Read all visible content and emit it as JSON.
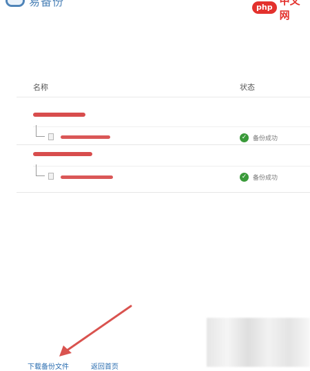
{
  "header": {
    "logo_text": "易备份",
    "watermark": {
      "badge": "php",
      "text": "中文网"
    }
  },
  "table": {
    "columns": {
      "name": "名称",
      "status": "状态"
    },
    "rows": [
      {
        "status_text": "备份成功"
      },
      {
        "status_text": "备份成功"
      }
    ]
  },
  "footer": {
    "links": [
      "下载备份文件",
      "返回首页"
    ]
  },
  "colors": {
    "accent": "#4f84b8",
    "success": "#3a9a3a",
    "redaction": "#d43a3a",
    "arrow": "#d9534f"
  }
}
